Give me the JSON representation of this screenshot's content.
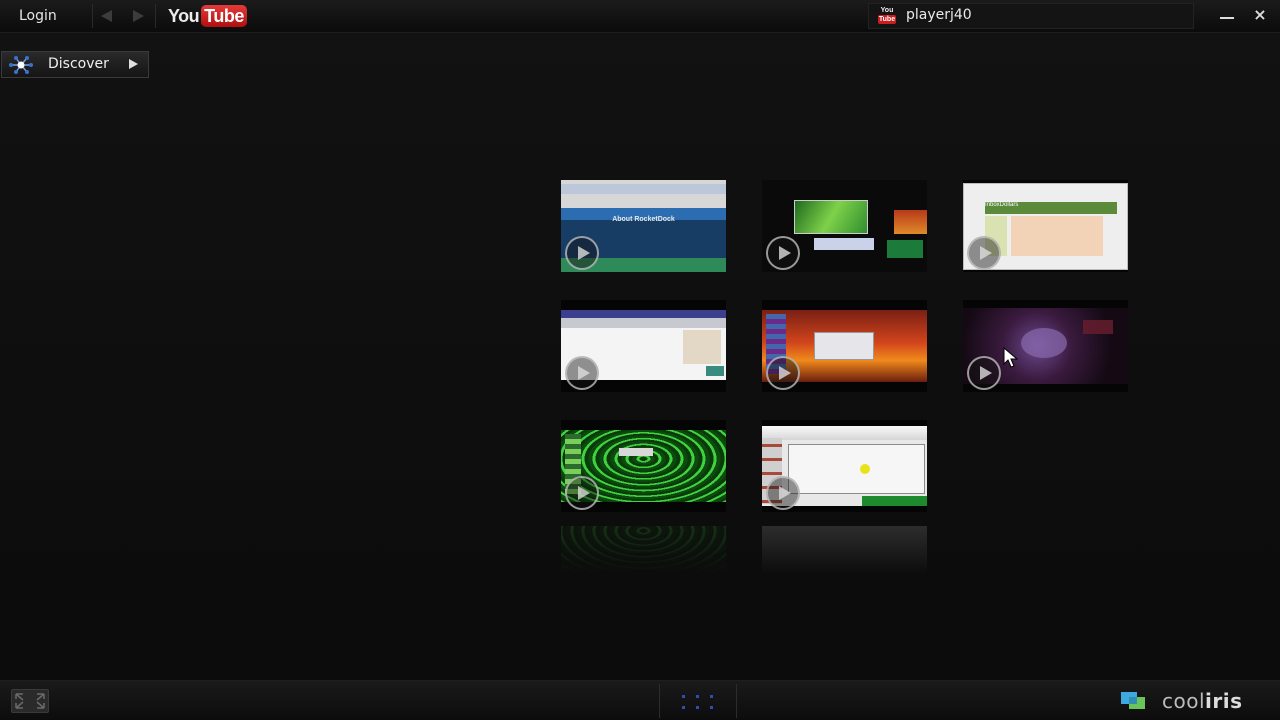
{
  "topbar": {
    "login_label": "Login",
    "logo_you": "You",
    "logo_tube": "Tube",
    "user_icon_you": "You",
    "user_icon_tube": "Tube",
    "username": "playerj40"
  },
  "discover": {
    "label": "Discover"
  },
  "videos": [
    {
      "subject": "About RocketDock webpage"
    },
    {
      "subject": "green desktop screenshot"
    },
    {
      "subject": "InboxDollars webpage"
    },
    {
      "subject": "white webpage screenshot"
    },
    {
      "subject": "orange desktop screenshot"
    },
    {
      "subject": "purple dark scene"
    },
    {
      "subject": "green matrix tunnel desktop"
    },
    {
      "subject": "window on desktop screenshot"
    }
  ],
  "thumb_text": {
    "rocketdock_title": "About RocketDock",
    "inbox_title": "InboxDollars"
  },
  "bottombar": {
    "brand_light": "cool",
    "brand_bold": "iris"
  },
  "colors": {
    "background": "#0d0d0d",
    "youtube_red": "#c91e1e",
    "accent_blue": "#3a6fd0"
  }
}
